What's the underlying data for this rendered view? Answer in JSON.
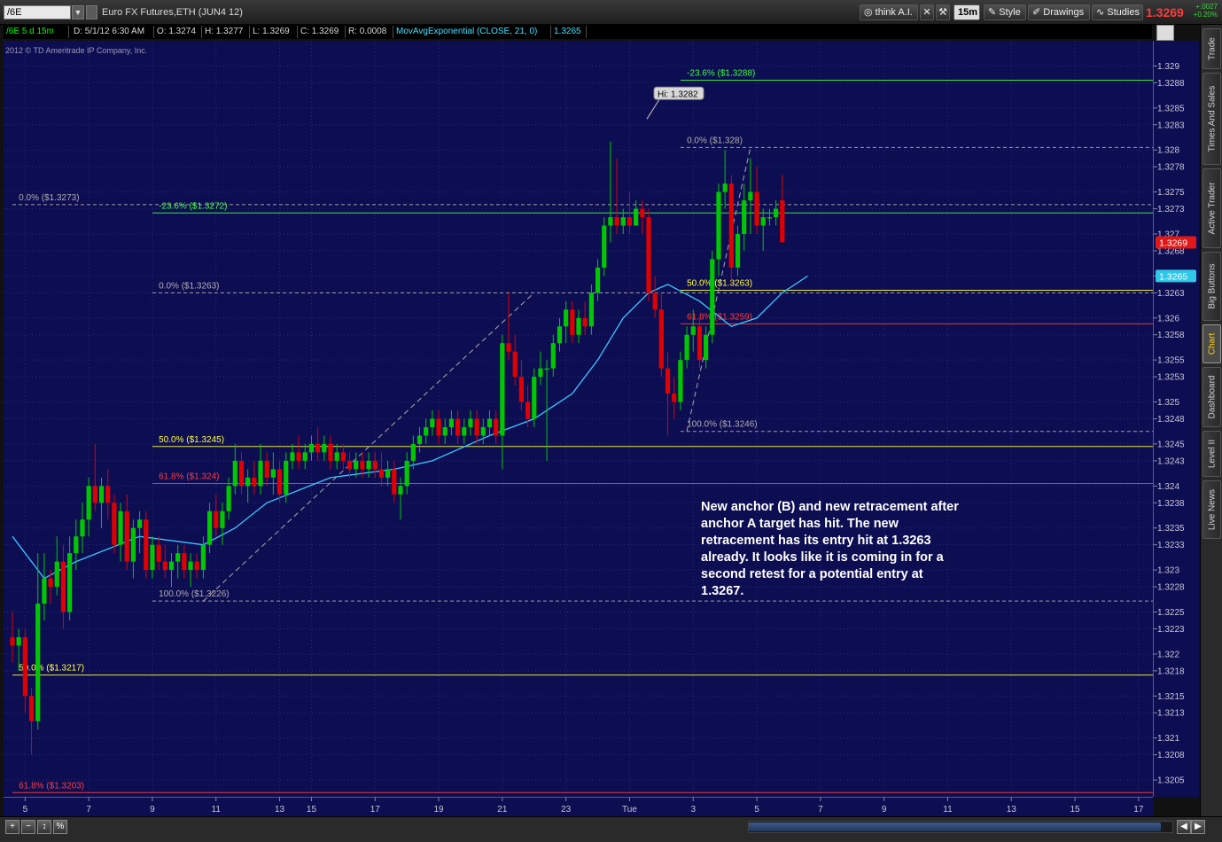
{
  "toolbar": {
    "symbol": "/6E",
    "description": "Euro FX Futures,ETH (JUN4 12)",
    "think_ai": "think A.I.",
    "interval": "15m",
    "style": "Style",
    "drawings": "Drawings",
    "studies": "Studies",
    "last_price": "1.3269",
    "net_change": "+.0027",
    "pct_change": "+0.20%"
  },
  "infobar": {
    "symbol_period": "/6E 5 d 15m",
    "date": "D: 5/1/12 6:30 AM",
    "open": "O: 1.3274",
    "high": "H: 1.3277",
    "low": "L: 1.3269",
    "close": "C: 1.3269",
    "range": "R: 0.0008",
    "study": "MovAvgExponential (CLOSE, 21, 0)",
    "study_value": "1.3265"
  },
  "copyright": "2012 © TD Ameritrade IP Company, Inc.",
  "annotation": "New anchor (B) and new retracement after anchor A target has hit. The new retracement has its entry hit at 1.3263 already. It looks like it is coming in for a second retest for a potential entry at 1.3267.",
  "sidebar_tabs": [
    "Trade",
    "Times And Sales",
    "Active Trader",
    "Big Buttons",
    "Chart",
    "Dashboard",
    "Level II",
    "Live News"
  ],
  "bottom_buttons": [
    "%"
  ],
  "colors": {
    "background": "#0d0d52",
    "up": "#00c800",
    "down": "#e00000",
    "ema": "#3cc8ff",
    "fib_green": "#3cff3c",
    "fib_yellow": "#ffff3c",
    "fib_red": "#ff3c3c",
    "fib_gray": "#b0b0b0"
  },
  "chart_data": {
    "type": "candlestick",
    "symbol": "/6E",
    "ylim": [
      1.3203,
      1.3293
    ],
    "y_ticks": [
      1.329,
      1.3288,
      1.3285,
      1.3283,
      1.328,
      1.3278,
      1.3275,
      1.3273,
      1.327,
      1.3268,
      1.3265,
      1.3263,
      1.326,
      1.3258,
      1.3255,
      1.3253,
      1.325,
      1.3248,
      1.3245,
      1.3243,
      1.324,
      1.3238,
      1.3235,
      1.3233,
      1.323,
      1.3228,
      1.3225,
      1.3223,
      1.322,
      1.3218,
      1.3215,
      1.3213,
      1.321,
      1.3208,
      1.3205
    ],
    "y_tick_labels": [
      "1.329",
      "1.3288",
      "1.3285",
      "1.3283",
      "1.328",
      "1.3278",
      "1.3275",
      "1.3273",
      "1.327",
      "1.3268",
      "1.3265",
      "1.3263",
      "1.326",
      "1.3258",
      "1.3255",
      "1.3253",
      "1.325",
      "1.3248",
      "1.3245",
      "1.3243",
      "1.324",
      "1.3238",
      "1.3235",
      "1.3233",
      "1.323",
      "1.3228",
      "1.3225",
      "1.3223",
      "1.322",
      "1.3218",
      "1.3215",
      "1.3213",
      "1.321",
      "1.3208",
      "1.3205"
    ],
    "x_ticks": [
      {
        "bar": 2,
        "label": "5"
      },
      {
        "bar": 12,
        "label": "7"
      },
      {
        "bar": 22,
        "label": "9"
      },
      {
        "bar": 32,
        "label": "11"
      },
      {
        "bar": 42,
        "label": "13"
      },
      {
        "bar": 47,
        "label": "15"
      },
      {
        "bar": 57,
        "label": "17"
      },
      {
        "bar": 67,
        "label": "19"
      },
      {
        "bar": 77,
        "label": "21"
      },
      {
        "bar": 87,
        "label": "23"
      },
      {
        "bar": 97,
        "label": "Tue"
      },
      {
        "bar": 107,
        "label": "3"
      },
      {
        "bar": 117,
        "label": "5"
      },
      {
        "bar": 127,
        "label": "7"
      },
      {
        "bar": 137,
        "label": "9"
      },
      {
        "bar": 147,
        "label": "11"
      },
      {
        "bar": 157,
        "label": "13"
      },
      {
        "bar": 167,
        "label": "15"
      },
      {
        "bar": 177,
        "label": "17"
      }
    ],
    "bars_visible": 180,
    "candles": [
      [
        1.3222,
        1.3225,
        1.3219,
        1.3221
      ],
      [
        1.3221,
        1.3223,
        1.3218,
        1.3222
      ],
      [
        1.3222,
        1.3223,
        1.3213,
        1.3215
      ],
      [
        1.3215,
        1.3216,
        1.3208,
        1.3212
      ],
      [
        1.3212,
        1.3232,
        1.3211,
        1.3226
      ],
      [
        1.3226,
        1.3232,
        1.3224,
        1.3229
      ],
      [
        1.3229,
        1.323,
        1.3226,
        1.3228
      ],
      [
        1.3228,
        1.3234,
        1.3227,
        1.3231
      ],
      [
        1.3231,
        1.3233,
        1.3223,
        1.3225
      ],
      [
        1.3225,
        1.3234,
        1.3224,
        1.3232
      ],
      [
        1.3232,
        1.3236,
        1.323,
        1.3234
      ],
      [
        1.3234,
        1.3238,
        1.3232,
        1.3236
      ],
      [
        1.3236,
        1.3241,
        1.3234,
        1.324
      ],
      [
        1.324,
        1.3245,
        1.3237,
        1.3238
      ],
      [
        1.3238,
        1.3241,
        1.3235,
        1.324
      ],
      [
        1.324,
        1.3242,
        1.3236,
        1.3238
      ],
      [
        1.3238,
        1.3239,
        1.3232,
        1.3233
      ],
      [
        1.3233,
        1.3238,
        1.3231,
        1.3237
      ],
      [
        1.3237,
        1.3239,
        1.323,
        1.3231
      ],
      [
        1.3231,
        1.3236,
        1.3229,
        1.3235
      ],
      [
        1.3235,
        1.3237,
        1.3232,
        1.3236
      ],
      [
        1.3236,
        1.3237,
        1.3229,
        1.323
      ],
      [
        1.323,
        1.3234,
        1.3229,
        1.3233
      ],
      [
        1.3233,
        1.3234,
        1.323,
        1.3231
      ],
      [
        1.3231,
        1.3233,
        1.3229,
        1.323
      ],
      [
        1.323,
        1.3232,
        1.3228,
        1.3231
      ],
      [
        1.3231,
        1.3233,
        1.3229,
        1.3232
      ],
      [
        1.3232,
        1.3233,
        1.3229,
        1.323
      ],
      [
        1.323,
        1.3232,
        1.3228,
        1.3231
      ],
      [
        1.3231,
        1.3232,
        1.3229,
        1.323
      ],
      [
        1.323,
        1.3234,
        1.3229,
        1.3233
      ],
      [
        1.3233,
        1.3238,
        1.3232,
        1.3237
      ],
      [
        1.3237,
        1.3239,
        1.3234,
        1.3235
      ],
      [
        1.3235,
        1.3238,
        1.3233,
        1.3237
      ],
      [
        1.3237,
        1.3241,
        1.3236,
        1.324
      ],
      [
        1.324,
        1.3245,
        1.3239,
        1.3243
      ],
      [
        1.3243,
        1.3244,
        1.3239,
        1.324
      ],
      [
        1.324,
        1.3242,
        1.3238,
        1.3241
      ],
      [
        1.3241,
        1.3243,
        1.3239,
        1.324
      ],
      [
        1.324,
        1.3245,
        1.3239,
        1.3243
      ],
      [
        1.3243,
        1.3244,
        1.324,
        1.3241
      ],
      [
        1.3241,
        1.3244,
        1.3239,
        1.3242
      ],
      [
        1.3242,
        1.3243,
        1.3238,
        1.3239
      ],
      [
        1.3239,
        1.3244,
        1.3238,
        1.3243
      ],
      [
        1.3243,
        1.3245,
        1.3242,
        1.3244
      ],
      [
        1.3244,
        1.3246,
        1.3242,
        1.3243
      ],
      [
        1.3243,
        1.3245,
        1.3242,
        1.3244
      ],
      [
        1.3244,
        1.3246,
        1.3243,
        1.3245
      ],
      [
        1.3245,
        1.3247,
        1.3243,
        1.3244
      ],
      [
        1.3244,
        1.3246,
        1.3243,
        1.3245
      ],
      [
        1.3245,
        1.3246,
        1.3242,
        1.3243
      ],
      [
        1.3243,
        1.3245,
        1.3242,
        1.3244
      ],
      [
        1.3244,
        1.3245,
        1.3242,
        1.3243
      ],
      [
        1.3243,
        1.3244,
        1.3241,
        1.3242
      ],
      [
        1.3242,
        1.3244,
        1.3241,
        1.3243
      ],
      [
        1.3243,
        1.3244,
        1.3241,
        1.3242
      ],
      [
        1.3242,
        1.3244,
        1.3241,
        1.3243
      ],
      [
        1.3243,
        1.3244,
        1.3241,
        1.3242
      ],
      [
        1.3242,
        1.3244,
        1.324,
        1.3241
      ],
      [
        1.3241,
        1.3243,
        1.324,
        1.3242
      ],
      [
        1.3242,
        1.3243,
        1.3238,
        1.3239
      ],
      [
        1.3239,
        1.3241,
        1.3236,
        1.324
      ],
      [
        1.324,
        1.3244,
        1.3239,
        1.3243
      ],
      [
        1.3243,
        1.3246,
        1.3242,
        1.3245
      ],
      [
        1.3245,
        1.3247,
        1.3244,
        1.3246
      ],
      [
        1.3246,
        1.3248,
        1.3245,
        1.3247
      ],
      [
        1.3247,
        1.3249,
        1.3246,
        1.3248
      ],
      [
        1.3248,
        1.3249,
        1.3245,
        1.3246
      ],
      [
        1.3246,
        1.3248,
        1.3245,
        1.3247
      ],
      [
        1.3247,
        1.3249,
        1.3246,
        1.3248
      ],
      [
        1.3248,
        1.3249,
        1.3245,
        1.3246
      ],
      [
        1.3246,
        1.3248,
        1.3245,
        1.3247
      ],
      [
        1.3247,
        1.3249,
        1.3246,
        1.3248
      ],
      [
        1.3248,
        1.3249,
        1.3245,
        1.3246
      ],
      [
        1.3246,
        1.3248,
        1.3245,
        1.3247
      ],
      [
        1.3247,
        1.3249,
        1.3246,
        1.3248
      ],
      [
        1.3248,
        1.3249,
        1.3245,
        1.3246
      ],
      [
        1.3246,
        1.3258,
        1.3242,
        1.3257
      ],
      [
        1.3257,
        1.3263,
        1.3255,
        1.3256
      ],
      [
        1.3256,
        1.3258,
        1.3252,
        1.3253
      ],
      [
        1.3253,
        1.3255,
        1.3249,
        1.325
      ],
      [
        1.325,
        1.3252,
        1.3247,
        1.3248
      ],
      [
        1.3248,
        1.3254,
        1.3247,
        1.3253
      ],
      [
        1.3253,
        1.3256,
        1.3252,
        1.3254
      ],
      [
        1.3254,
        1.3255,
        1.3243,
        1.3254
      ],
      [
        1.3254,
        1.3258,
        1.3253,
        1.3257
      ],
      [
        1.3257,
        1.326,
        1.3256,
        1.3259
      ],
      [
        1.3259,
        1.3262,
        1.3257,
        1.3261
      ],
      [
        1.3261,
        1.3262,
        1.3257,
        1.3258
      ],
      [
        1.3258,
        1.3261,
        1.3257,
        1.326
      ],
      [
        1.326,
        1.3262,
        1.3258,
        1.3259
      ],
      [
        1.3259,
        1.3264,
        1.3258,
        1.3263
      ],
      [
        1.3263,
        1.3267,
        1.3262,
        1.3266
      ],
      [
        1.3266,
        1.3272,
        1.3265,
        1.3271
      ],
      [
        1.3271,
        1.3281,
        1.3269,
        1.3272
      ],
      [
        1.3272,
        1.3279,
        1.327,
        1.3271
      ],
      [
        1.3271,
        1.3273,
        1.327,
        1.3272
      ],
      [
        1.3272,
        1.3275,
        1.327,
        1.3271
      ],
      [
        1.3271,
        1.3274,
        1.3271,
        1.3273
      ],
      [
        1.3273,
        1.3274,
        1.327,
        1.3272
      ],
      [
        1.3272,
        1.3273,
        1.3262,
        1.3263
      ],
      [
        1.3263,
        1.3265,
        1.326,
        1.3261
      ],
      [
        1.3261,
        1.3263,
        1.3253,
        1.3254
      ],
      [
        1.3254,
        1.3256,
        1.3246,
        1.3251
      ],
      [
        1.3251,
        1.3253,
        1.3248,
        1.325
      ],
      [
        1.325,
        1.3256,
        1.3249,
        1.3255
      ],
      [
        1.3255,
        1.3259,
        1.3254,
        1.3258
      ],
      [
        1.3258,
        1.3261,
        1.3256,
        1.3259
      ],
      [
        1.3259,
        1.326,
        1.3254,
        1.3255
      ],
      [
        1.3255,
        1.3259,
        1.3254,
        1.3258
      ],
      [
        1.3258,
        1.3268,
        1.3257,
        1.3267
      ],
      [
        1.3267,
        1.3276,
        1.3265,
        1.3275
      ],
      [
        1.3275,
        1.328,
        1.3273,
        1.3276
      ],
      [
        1.3276,
        1.3277,
        1.3264,
        1.3266
      ],
      [
        1.3266,
        1.3271,
        1.3265,
        1.327
      ],
      [
        1.327,
        1.3276,
        1.3268,
        1.3274
      ],
      [
        1.3274,
        1.3279,
        1.327,
        1.3275
      ],
      [
        1.3275,
        1.3278,
        1.327,
        1.3271
      ],
      [
        1.3271,
        1.3273,
        1.3268,
        1.3272
      ],
      [
        1.3272,
        1.3273,
        1.3271,
        1.3272
      ],
      [
        1.3272,
        1.3274,
        1.3271,
        1.3273
      ],
      [
        1.3274,
        1.3277,
        1.3269,
        1.3269
      ]
    ],
    "ema": {
      "name": "MovAvgExponential (CLOSE, 21, 0)",
      "points": [
        [
          0,
          1.3234
        ],
        [
          5,
          1.3229
        ],
        [
          10,
          1.3231
        ],
        [
          20,
          1.3234
        ],
        [
          30,
          1.3233
        ],
        [
          35,
          1.3235
        ],
        [
          40,
          1.3238
        ],
        [
          50,
          1.3241
        ],
        [
          60,
          1.3242
        ],
        [
          66,
          1.3243
        ],
        [
          75,
          1.3246
        ],
        [
          82,
          1.3248
        ],
        [
          88,
          1.3251
        ],
        [
          92,
          1.3255
        ],
        [
          96,
          1.326
        ],
        [
          100,
          1.3263
        ],
        [
          103,
          1.3264
        ],
        [
          108,
          1.3262
        ],
        [
          113,
          1.3259
        ],
        [
          117,
          1.326
        ],
        [
          121,
          1.3263
        ],
        [
          125,
          1.3265
        ]
      ]
    },
    "annotations": [
      {
        "type": "fib",
        "bar_start": 0,
        "bar_end": 179,
        "y": 1.32735,
        "color": "gray",
        "dashed": true,
        "label": "0.0%  ($1.3273)",
        "label_bar": 1
      },
      {
        "type": "fib",
        "bar_start": 0,
        "bar_end": 179,
        "y": 1.32175,
        "color": "yellow",
        "dashed": false,
        "label": "50.0%  ($1.3217)",
        "label_bar": 1
      },
      {
        "type": "fib",
        "bar_start": 0,
        "bar_end": 179,
        "y": 1.32035,
        "color": "red",
        "dashed": false,
        "label": "61.8%  ($1.3203)",
        "label_bar": 1
      },
      {
        "type": "fib",
        "bar_start": 22,
        "bar_end": 179,
        "y": 1.32725,
        "color": "green",
        "dashed": false,
        "label": "-23.6%  ($1.3272)",
        "label_bar": 23
      },
      {
        "type": "fib",
        "bar_start": 22,
        "bar_end": 179,
        "y": 1.3263,
        "color": "gray",
        "dashed": true,
        "label": "0.0%  ($1.3263)",
        "label_bar": 23
      },
      {
        "type": "fib",
        "bar_start": 22,
        "bar_end": 179,
        "y": 1.32447,
        "color": "yellow",
        "dashed": false,
        "label": "50.0%  ($1.3245)",
        "label_bar": 23
      },
      {
        "type": "fib",
        "bar_start": 22,
        "bar_end": 179,
        "y": 1.32403,
        "color": "red",
        "dashed": false,
        "label": "61.8%  ($1.324)",
        "label_bar": 23
      },
      {
        "type": "fib",
        "bar_start": 22,
        "bar_end": 179,
        "y": 1.32263,
        "color": "gray",
        "dashed": true,
        "label": "100.0%  ($1.3226)",
        "label_bar": 23
      },
      {
        "type": "fib",
        "bar_start": 105,
        "bar_end": 179,
        "y": 1.32883,
        "color": "green",
        "dashed": false,
        "label": "-23.6%  ($1.3288)",
        "label_bar": 106
      },
      {
        "type": "fib",
        "bar_start": 105,
        "bar_end": 179,
        "y": 1.32803,
        "color": "gray",
        "dashed": true,
        "label": "0.0%  ($1.328)",
        "label_bar": 106
      },
      {
        "type": "fib",
        "bar_start": 105,
        "bar_end": 179,
        "y": 1.32633,
        "color": "yellow",
        "dashed": false,
        "label": "50.0%  ($1.3263)",
        "label_bar": 106
      },
      {
        "type": "fib",
        "bar_start": 105,
        "bar_end": 179,
        "y": 1.32593,
        "color": "red",
        "dashed": false,
        "label": "61.8%  ($1.3259)",
        "label_bar": 106
      },
      {
        "type": "fib",
        "bar_start": 105,
        "bar_end": 179,
        "y": 1.32465,
        "color": "gray",
        "dashed": true,
        "label": "100.0%  ($1.3246)",
        "label_bar": 106
      }
    ],
    "trendlines": [
      {
        "from": [
          30,
          1.32263
        ],
        "to": [
          82,
          1.3263
        ]
      },
      {
        "from": [
          106,
          1.32465
        ],
        "to": [
          116,
          1.32803
        ]
      }
    ],
    "high_bubble": {
      "bar": 100,
      "y": 1.3282,
      "label": "Hi: 1.3282"
    },
    "price_tags": [
      {
        "y": 1.3269,
        "label": "1.3269",
        "color": "#e01818"
      },
      {
        "y": 1.3265,
        "label": "1.3265",
        "color": "#30c8e8"
      }
    ]
  }
}
